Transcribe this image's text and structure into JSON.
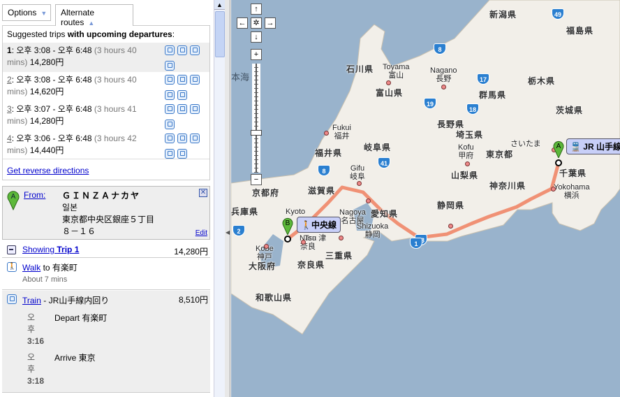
{
  "tabs": {
    "options": "Options",
    "alternate": "Alternate routes"
  },
  "suggested": {
    "prefix": "Suggested trips ",
    "bold": "with upcoming departures",
    "suffix": ":"
  },
  "trips": [
    {
      "num": "1",
      "time": "오후 3:08 - 오후 6:48",
      "dur_a": "(3 hours 40",
      "dur_b": "mins)",
      "price": "14,280円",
      "icons": 4
    },
    {
      "num": "2",
      "time": "오후 3:08 - 오후 6:48",
      "dur_a": "(3 hours 40",
      "dur_b": "mins)",
      "price": "14,620円",
      "icons": 5
    },
    {
      "num": "3",
      "time": "오후 3:07 - 오후 6:48",
      "dur_a": "(3 hours 41",
      "dur_b": "mins)",
      "price": "14,280円",
      "icons": 4
    },
    {
      "num": "4",
      "time": "오후 3:06 - 오후 6:48",
      "dur_a": "(3 hours 42",
      "dur_b": "mins)",
      "price": "14,440円",
      "icons": 5
    }
  ],
  "reverse_link": "Get reverse directions",
  "from": {
    "label": "From:",
    "name": "ＧＩＮＺＡナカヤ",
    "country": "일본",
    "address": "東京都中央区銀座５丁目",
    "number": "８－１６",
    "edit": "Edit",
    "pin": "A"
  },
  "showing": {
    "prefix": "Showing ",
    "trip": "Trip 1",
    "price": "14,280円"
  },
  "walk": {
    "link": "Walk",
    "rest": " to 有楽町",
    "duration": "About 7 mins"
  },
  "train": {
    "link": "Train",
    "line": " - JR山手線内回り",
    "price": "8,510円",
    "stops": [
      {
        "ampm": "오",
        "ampm2": "후",
        "time": "3:16",
        "desc": "Depart 有楽町"
      },
      {
        "ampm": "오",
        "ampm2": "후",
        "time": "3:18",
        "desc": "Arrive 東京"
      }
    ]
  },
  "map": {
    "colors": {
      "sea": "#99b3cc",
      "land": "#f2efe9",
      "route": "#f08060"
    },
    "prefectures": [
      "新潟県",
      "福島県",
      "石川県",
      "富山県",
      "栃木県",
      "群馬県",
      "長野県",
      "茨城県",
      "埼玉県",
      "福井県",
      "岐阜県",
      "東京都",
      "山梨県",
      "千葉県",
      "神奈川県",
      "京都府",
      "滋賀県",
      "兵庫県",
      "愛知県",
      "静岡県",
      "大阪府",
      "奈良県",
      "三重県",
      "和歌山県"
    ],
    "cities": [
      "Toyama\n富山",
      "Nagano\n長野",
      "Fukui\n福井",
      "Gifu\n岐阜",
      "Kofu\n甲府",
      "Yokohama\n横浜",
      "Kyoto",
      "Nagoya\n名古屋",
      "Kobe\n神戸",
      "Nara\n奈良",
      "Tsu 津",
      "Shizuoka\n静岡",
      "さいたま"
    ],
    "sea_label": "本海",
    "shields": [
      "49",
      "8",
      "17",
      "19",
      "18",
      "41",
      "8",
      "2",
      "23",
      "1"
    ],
    "marker_a": "A",
    "marker_b": "B",
    "bubble_a": "JR 山手線",
    "bubble_b": "中央線",
    "nav": {
      "up": "↑",
      "left": "←",
      "center": "✲",
      "right": "→",
      "down": "↓",
      "zoom_in": "+",
      "zoom_out": "−"
    }
  }
}
